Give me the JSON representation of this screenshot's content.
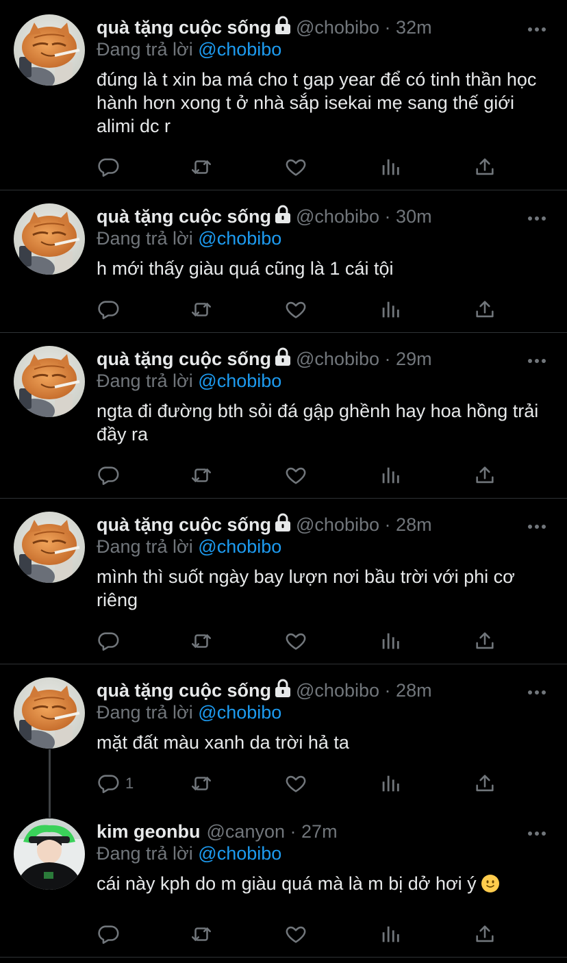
{
  "colors": {
    "background": "#000000",
    "text": "#e7e9ea",
    "muted": "#71767b",
    "link": "#1d9bf0",
    "separator": "#2f3336"
  },
  "tweets": [
    {
      "name": "quà tặng cuộc sống",
      "handle": "@chobibo",
      "time": "32m",
      "replying_label": "Đang trả lời",
      "replying_to": "@chobibo",
      "text": "đúng là t xin ba má cho t gap year để có tinh thần học hành hơn xong t ở nhà sắp isekai mẹ sang thế giới alimi dc r",
      "reply_count": "",
      "protected": true,
      "avatar": "cat-avatar"
    },
    {
      "name": "quà tặng cuộc sống",
      "handle": "@chobibo",
      "time": "30m",
      "replying_label": "Đang trả lời",
      "replying_to": "@chobibo",
      "text": "h mới thấy giàu quá cũng là 1 cái tội",
      "reply_count": "",
      "protected": true,
      "avatar": "cat-avatar"
    },
    {
      "name": "quà tặng cuộc sống",
      "handle": "@chobibo",
      "time": "29m",
      "replying_label": "Đang trả lời",
      "replying_to": "@chobibo",
      "text": "ngta đi đường bth sỏi đá gập ghềnh hay hoa hồng trải đầy ra",
      "reply_count": "",
      "protected": true,
      "avatar": "cat-avatar"
    },
    {
      "name": "quà tặng cuộc sống",
      "handle": "@chobibo",
      "time": "28m",
      "replying_label": "Đang trả lời",
      "replying_to": "@chobibo",
      "text": "mình thì suốt ngày bay lượn nơi bầu trời với phi cơ riêng",
      "reply_count": "",
      "protected": true,
      "avatar": "cat-avatar"
    },
    {
      "name": "quà tặng cuộc sống",
      "handle": "@chobibo",
      "time": "28m",
      "replying_label": "Đang trả lời",
      "replying_to": "@chobibo",
      "text": "mặt đất màu xanh da trời hả ta",
      "reply_count": "1",
      "protected": true,
      "avatar": "cat-avatar"
    },
    {
      "name": "kim geonbu",
      "handle": "@canyon",
      "time": "27m",
      "replying_label": "Đang trả lời",
      "replying_to": "@chobibo",
      "text": "cái này kph do m giàu quá mà là m bị dở hơi ý",
      "emoji": "slightly-smiling-face",
      "reply_count": "",
      "protected": false,
      "avatar": "person-avatar"
    }
  ],
  "sep_char": "·"
}
